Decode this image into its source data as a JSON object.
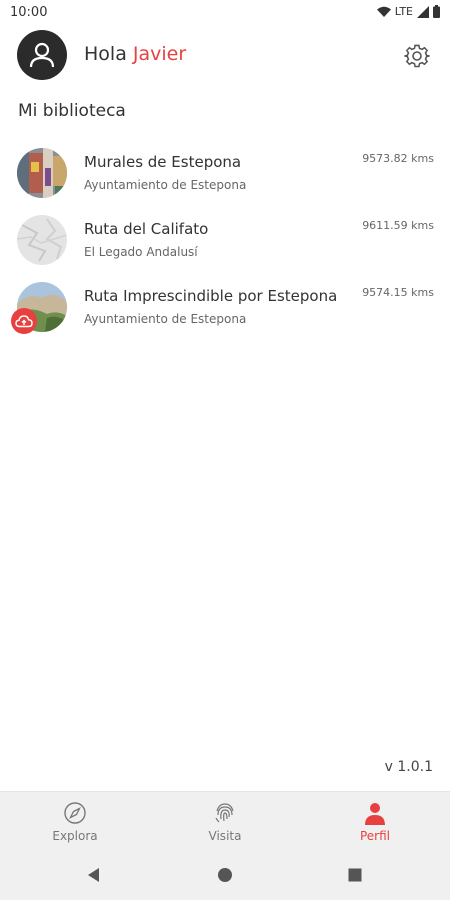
{
  "status_bar": {
    "time": "10:00",
    "network": "LTE"
  },
  "header": {
    "greeting": "Hola",
    "user_name": "Javier"
  },
  "library": {
    "title": "Mi biblioteca",
    "routes": [
      {
        "title": "Murales de Estepona",
        "subtitle": "Ayuntamiento de Estepona",
        "distance": "9573.82 kms"
      },
      {
        "title": "Ruta del Califato",
        "subtitle": "El Legado Andalusí",
        "distance": "9611.59 kms"
      },
      {
        "title": "Ruta Imprescindible por Estepona",
        "subtitle": "Ayuntamiento de Estepona",
        "distance": "9574.15 kms"
      }
    ]
  },
  "version": "v 1.0.1",
  "bottom_nav": {
    "items": [
      {
        "label": "Explora",
        "icon": "compass-icon"
      },
      {
        "label": "Visita",
        "icon": "fingerprint-icon"
      },
      {
        "label": "Perfil",
        "icon": "person-icon",
        "active": true
      }
    ]
  },
  "colors": {
    "accent": "#e8403f",
    "nav_background": "#f0f0f0",
    "text": "#333333"
  }
}
